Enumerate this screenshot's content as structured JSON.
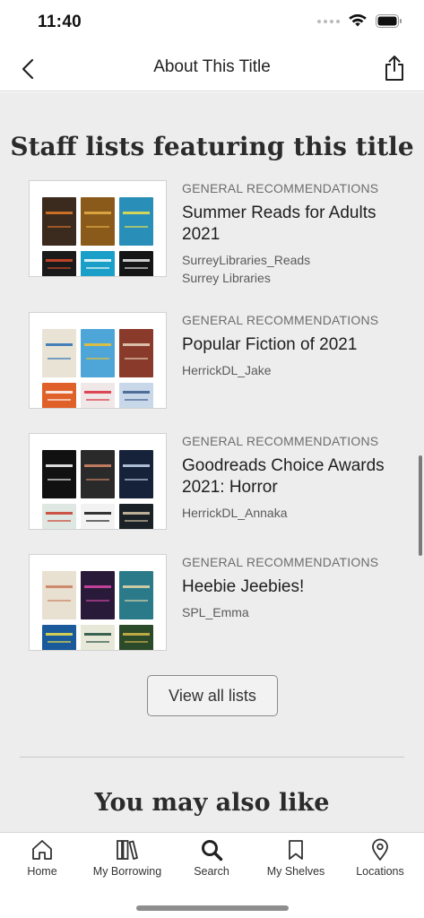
{
  "status_bar": {
    "time": "11:40"
  },
  "header": {
    "title": "About This Title"
  },
  "section": {
    "title": "Staff lists featuring this title",
    "lists": [
      {
        "category": "GENERAL RECOMMENDATIONS",
        "title": "Summer Reads for Adults 2021",
        "subtitle": "SurreyLibraries_Reads",
        "subtitle2": "Surrey Libraries",
        "covers": [
          {
            "bg": "#3b2a1e",
            "accent": "#e07a2a",
            "text": "JOHN GRISHAM"
          },
          {
            "bg": "#8a5a1a",
            "accent": "#e8b04a",
            "text": "FIRE"
          },
          {
            "bg": "#2a8fb8",
            "accent": "#f2e24a",
            "text": "UNDER THE WAVE"
          },
          {
            "bg": "#1a1a1a",
            "accent": "#d94a2a",
            "text": "KRISTIN HANNAH"
          },
          {
            "bg": "#1aa0c8",
            "accent": "#ffffff",
            "text": "The Kindest"
          },
          {
            "bg": "#151515",
            "accent": "#eeeeee",
            "text": "ANDY WEIR"
          }
        ]
      },
      {
        "category": "GENERAL RECOMMENDATIONS",
        "title": "Popular Fiction of 2021",
        "subtitle": "HerrickDL_Jake",
        "covers": [
          {
            "bg": "#e9e3d6",
            "accent": "#2a6fb3",
            "text": "INFINITE COUNTRY"
          },
          {
            "bg": "#4ea6d8",
            "accent": "#f2c12a",
            "text": "CLOUD CUCKOO LAND"
          },
          {
            "bg": "#8a3a2a",
            "accent": "#e8d6c0",
            "text": "ONCE THERE WERE WOLVES"
          },
          {
            "bg": "#e0602a",
            "accent": "#ffffff",
            "text": "RAZORBLADE TEARS"
          },
          {
            "bg": "#f0e8e8",
            "accent": "#d8283a",
            "text": "ALICE FEENEY"
          },
          {
            "bg": "#c8d8e8",
            "accent": "#3a5a8a",
            "text": "LOCAL"
          }
        ]
      },
      {
        "category": "GENERAL RECOMMENDATIONS",
        "title": "Goodreads Choice Awards 2021: Horror",
        "subtitle": "HerrickDL_Annaka",
        "covers": [
          {
            "bg": "#111111",
            "accent": "#ffffff",
            "text": "WHERE THEY WAIT"
          },
          {
            "bg": "#2a2a2a",
            "accent": "#d88a6a",
            "text": "HOUSE"
          },
          {
            "bg": "#16213a",
            "accent": "#c8d8f0",
            "text": "NEAR THE BONE"
          },
          {
            "bg": "#dfe7e2",
            "accent": "#c83a2a",
            "text": "BOOK"
          },
          {
            "bg": "#f2f2f2",
            "accent": "#111111",
            "text": "MY HEART"
          },
          {
            "bg": "#1a2228",
            "accent": "#d8c8a8",
            "text": "CHASING"
          }
        ]
      },
      {
        "category": "GENERAL RECOMMENDATIONS",
        "title": "Heebie Jeebies!",
        "subtitle": "SPL_Emma",
        "covers": [
          {
            "bg": "#e8e0d0",
            "accent": "#c87a5a",
            "text": "MAPPING THE INTERIOR"
          },
          {
            "bg": "#2a1a3a",
            "accent": "#d84aa8",
            "text": "CATHERINE HOUSE"
          },
          {
            "bg": "#2a7a8a",
            "accent": "#e8d8a8",
            "text": "SPINSTERS"
          },
          {
            "bg": "#1a5a9a",
            "accent": "#f2e24a",
            "text": "DEEP"
          },
          {
            "bg": "#e8e8d8",
            "accent": "#1a4a3a",
            "text": "Frankenstein"
          },
          {
            "bg": "#2a4a2a",
            "accent": "#d8b84a",
            "text": "MEXICAN"
          }
        ]
      }
    ],
    "view_all_label": "View all lists"
  },
  "may_like_title": "You may also like",
  "tabs": [
    {
      "label": "Home",
      "icon": "home-icon"
    },
    {
      "label": "My Borrowing",
      "icon": "books-icon"
    },
    {
      "label": "Search",
      "icon": "search-icon"
    },
    {
      "label": "My Shelves",
      "icon": "bookmark-icon"
    },
    {
      "label": "Locations",
      "icon": "location-pin-icon"
    }
  ]
}
